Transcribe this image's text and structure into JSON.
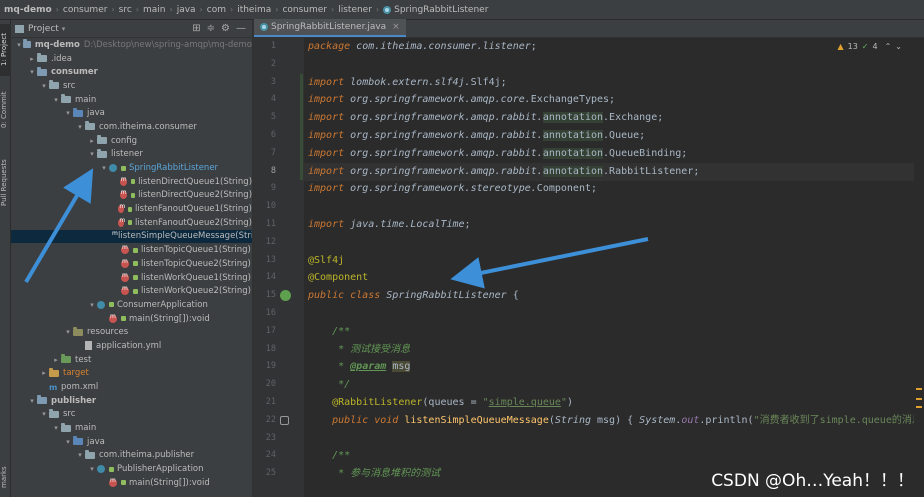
{
  "breadcrumb": {
    "items": [
      "mq-demo",
      "consumer",
      "src",
      "main",
      "java",
      "com",
      "itheima",
      "consumer",
      "listener",
      "SpringRabbitListener"
    ]
  },
  "sidebar_tabs": {
    "project": "1: Project",
    "commit": "0: Commit",
    "pull_requests": "Pull Requests",
    "marks": "marks"
  },
  "project_panel": {
    "title": "Project",
    "tree": [
      {
        "label": "mq-demo",
        "extra": "D:\\Desktop\\new\\spring-amqp\\mq-demo",
        "indent": 0,
        "arrow": "▾",
        "icon": "folder-module-icon",
        "bold": true
      },
      {
        "label": ".idea",
        "indent": 1,
        "arrow": "▸",
        "icon": "folder-icon"
      },
      {
        "label": "consumer",
        "indent": 1,
        "arrow": "▾",
        "icon": "folder-module-icon",
        "bold": true
      },
      {
        "label": "src",
        "indent": 2,
        "arrow": "▾",
        "icon": "folder-icon"
      },
      {
        "label": "main",
        "indent": 3,
        "arrow": "▾",
        "icon": "folder-icon"
      },
      {
        "label": "java",
        "indent": 4,
        "arrow": "▾",
        "icon": "folder-source-icon"
      },
      {
        "label": "com.itheima.consumer",
        "indent": 5,
        "arrow": "▾",
        "icon": "folder-icon"
      },
      {
        "label": "config",
        "indent": 6,
        "arrow": "▸",
        "icon": "folder-icon"
      },
      {
        "label": "listener",
        "indent": 6,
        "arrow": "▾",
        "icon": "folder-icon"
      },
      {
        "label": "SpringRabbitListener",
        "indent": 7,
        "arrow": "▾",
        "icon": "class-icon",
        "highlight": true
      },
      {
        "label": "listenDirectQueue1(String)",
        "indent": 8,
        "arrow": "",
        "icon": "method-icon"
      },
      {
        "label": "listenDirectQueue2(String)",
        "indent": 8,
        "arrow": "",
        "icon": "method-icon"
      },
      {
        "label": "listenFanoutQueue1(String)",
        "indent": 8,
        "arrow": "",
        "icon": "method-icon"
      },
      {
        "label": "listenFanoutQueue2(String)",
        "indent": 8,
        "arrow": "",
        "icon": "method-icon"
      },
      {
        "label": "listenSimpleQueueMessage(String)",
        "indent": 8,
        "arrow": "",
        "icon": "method-icon",
        "selected": true
      },
      {
        "label": "listenTopicQueue1(String)",
        "indent": 8,
        "arrow": "",
        "icon": "method-icon"
      },
      {
        "label": "listenTopicQueue2(String)",
        "indent": 8,
        "arrow": "",
        "icon": "method-icon"
      },
      {
        "label": "listenWorkQueue1(String)",
        "indent": 8,
        "arrow": "",
        "icon": "method-icon"
      },
      {
        "label": "listenWorkQueue2(String)",
        "indent": 8,
        "arrow": "",
        "icon": "method-icon"
      },
      {
        "label": "ConsumerApplication",
        "indent": 6,
        "arrow": "▾",
        "icon": "class-icon"
      },
      {
        "label": "main(String[]):void",
        "indent": 7,
        "arrow": "",
        "icon": "method-icon"
      },
      {
        "label": "resources",
        "indent": 4,
        "arrow": "▾",
        "icon": "folder-resources-icon"
      },
      {
        "label": "application.yml",
        "indent": 5,
        "arrow": "",
        "icon": "file-icon"
      },
      {
        "label": "test",
        "indent": 3,
        "arrow": "▸",
        "icon": "folder-test-icon"
      },
      {
        "label": "target",
        "indent": 2,
        "arrow": "▸",
        "icon": "folder-target-icon",
        "orange": true
      },
      {
        "label": "pom.xml",
        "indent": 2,
        "arrow": "",
        "icon": "pom-icon"
      },
      {
        "label": "publisher",
        "indent": 1,
        "arrow": "▾",
        "icon": "folder-module-icon",
        "bold": true
      },
      {
        "label": "src",
        "indent": 2,
        "arrow": "▾",
        "icon": "folder-icon"
      },
      {
        "label": "main",
        "indent": 3,
        "arrow": "▾",
        "icon": "folder-icon"
      },
      {
        "label": "java",
        "indent": 4,
        "arrow": "▾",
        "icon": "folder-source-icon"
      },
      {
        "label": "com.itheima.publisher",
        "indent": 5,
        "arrow": "▾",
        "icon": "folder-icon"
      },
      {
        "label": "PublisherApplication",
        "indent": 6,
        "arrow": "▾",
        "icon": "class-icon"
      },
      {
        "label": "main(String[]):void",
        "indent": 7,
        "arrow": "",
        "icon": "method-icon"
      }
    ]
  },
  "editor": {
    "tab_label": "SpringRabbitListener.java",
    "warnings": {
      "warn_count": "13",
      "ok_count": "4"
    },
    "current_line": 8,
    "line_numbers": [
      "1",
      "2",
      "3",
      "4",
      "5",
      "6",
      "7",
      "8",
      "9",
      "10",
      "11",
      "12",
      "13",
      "14",
      "15",
      "16",
      "17",
      "18",
      "19",
      "20",
      "21",
      "22",
      "23",
      "24",
      "25"
    ]
  },
  "watermark": "CSDN @Oh…Yeah！！！",
  "colors": {
    "accent": "#4a88c7",
    "arrow": "#3d8fd8",
    "selection": "#0d293e"
  }
}
